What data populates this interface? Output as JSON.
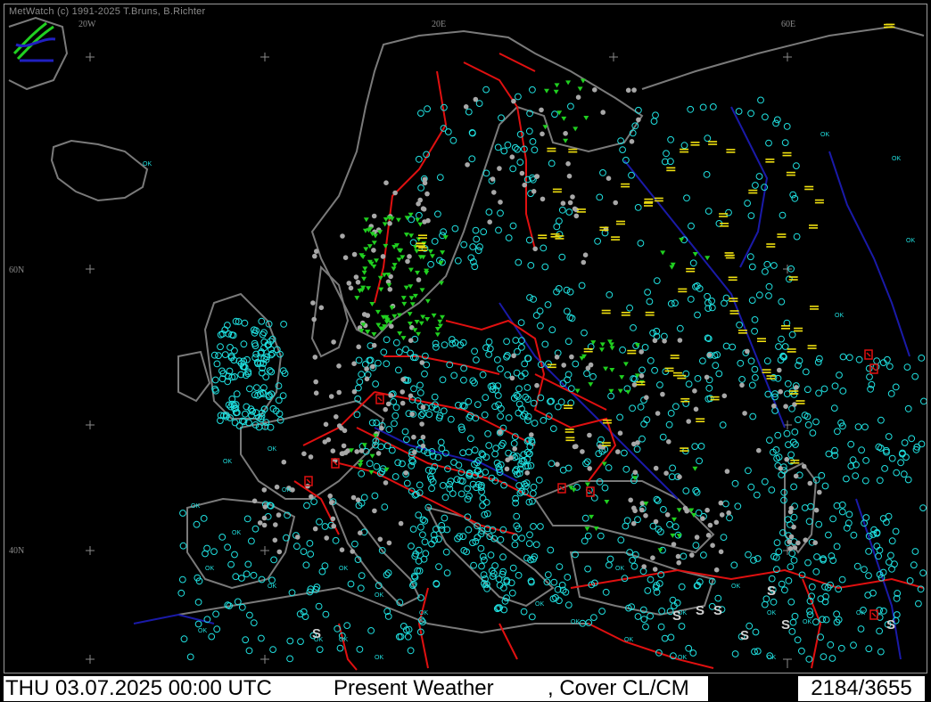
{
  "app": {
    "credit": "MetWatch  (c) 1991-2025 T.Bruns, B.Richter"
  },
  "map": {
    "grid_labels": {
      "lon_20w": "20W",
      "lon_20e": "20E",
      "lon_60e": "60E",
      "lat_60n": "60N",
      "lat_40n": "40N"
    },
    "colors": {
      "background": "#000000",
      "coastline": "#7a7a7a",
      "borders": "#e01010",
      "rivers": "#1010a0",
      "cover_symbol": "#20e0e0",
      "rain_symbol": "#20d020",
      "haze_symbol": "#f0e010",
      "ok_text": "#20e0e0"
    },
    "symbols": {
      "ok": "OK",
      "dust_s": "S"
    }
  },
  "status": {
    "date_time": "THU 03.07.2025 00:00 UTC",
    "product": "Present Weather",
    "layer": ", Cover CL/CM",
    "count": "2184/3655"
  }
}
